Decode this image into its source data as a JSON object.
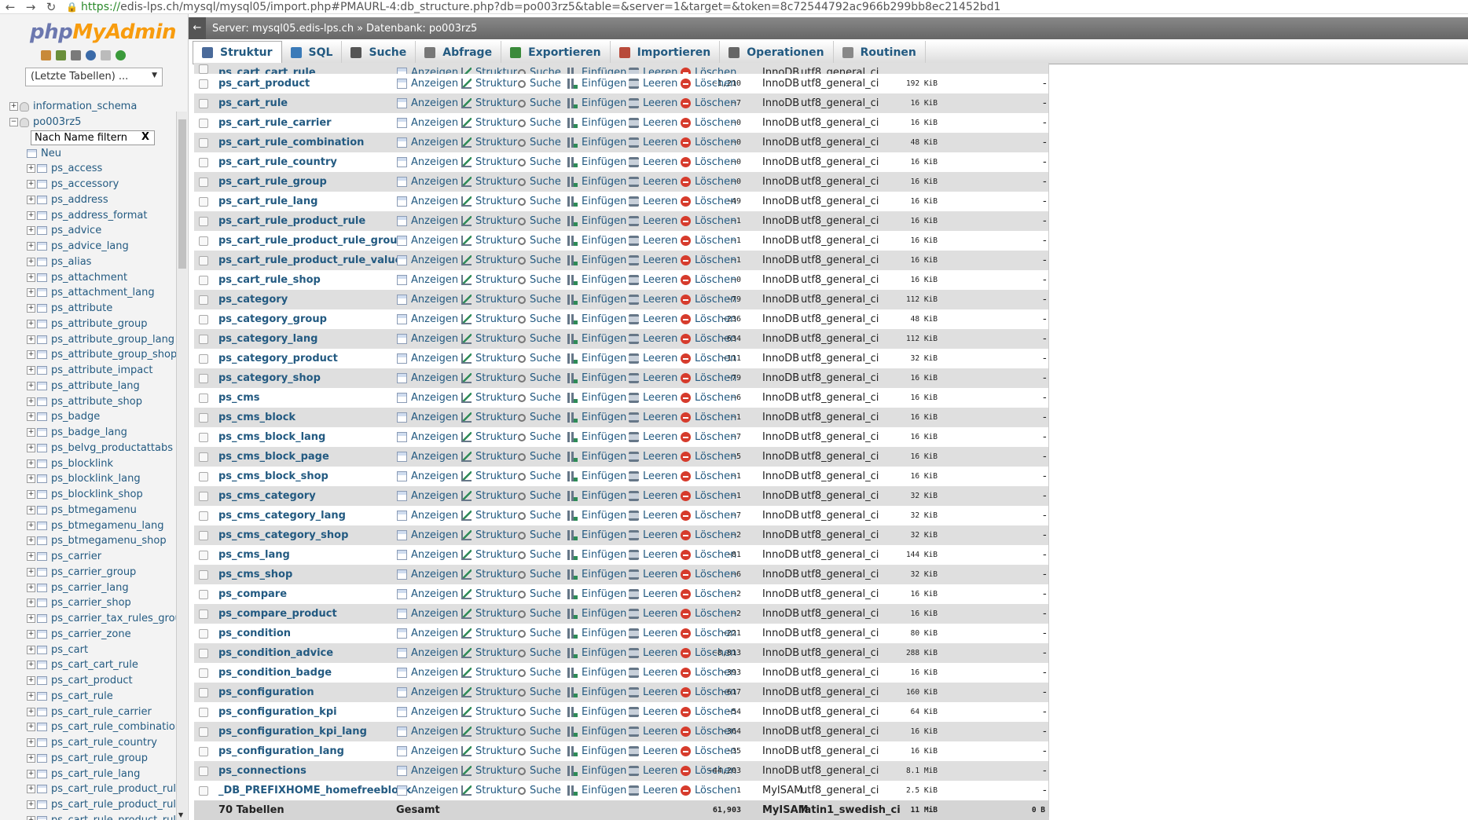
{
  "browser": {
    "url_scheme": "https://",
    "url_rest": "edis-lps.ch/mysql/mysql05/import.php#PMAURL-4:db_structure.php?db=po003rz5&table=&server=1&target=&token=8c72544792ac966b299bb8ec21452bd1"
  },
  "logo": {
    "php": "php",
    "my": "My",
    "admin": "Admin"
  },
  "sidebar": {
    "recent_tables": "(Letzte Tabellen) ...",
    "filter_placeholder": "Nach Name filtern",
    "filter_clear": "X",
    "new_label": "Neu",
    "databases": [
      "information_schema",
      "po003rz5"
    ],
    "tables": [
      "ps_access",
      "ps_accessory",
      "ps_address",
      "ps_address_format",
      "ps_advice",
      "ps_advice_lang",
      "ps_alias",
      "ps_attachment",
      "ps_attachment_lang",
      "ps_attribute",
      "ps_attribute_group",
      "ps_attribute_group_lang",
      "ps_attribute_group_shop",
      "ps_attribute_impact",
      "ps_attribute_lang",
      "ps_attribute_shop",
      "ps_badge",
      "ps_badge_lang",
      "ps_belvg_productattabs",
      "ps_blocklink",
      "ps_blocklink_lang",
      "ps_blocklink_shop",
      "ps_btmegamenu",
      "ps_btmegamenu_lang",
      "ps_btmegamenu_shop",
      "ps_carrier",
      "ps_carrier_group",
      "ps_carrier_lang",
      "ps_carrier_shop",
      "ps_carrier_tax_rules_grou",
      "ps_carrier_zone",
      "ps_cart",
      "ps_cart_cart_rule",
      "ps_cart_product",
      "ps_cart_rule",
      "ps_cart_rule_carrier",
      "ps_cart_rule_combination",
      "ps_cart_rule_country",
      "ps_cart_rule_group",
      "ps_cart_rule_lang",
      "ps_cart_rule_product_rule",
      "ps_cart_rule_product_rule",
      "ps_cart_rule_product_rule"
    ]
  },
  "breadcrumb": {
    "server": "Server: mysql05.edis-lps.ch",
    "sep": "»",
    "database": "Datenbank: po003rz5"
  },
  "tabs": [
    "Struktur",
    "SQL",
    "Suche",
    "Abfrage",
    "Exportieren",
    "Importieren",
    "Operationen",
    "Routinen"
  ],
  "actions": {
    "view": "Anzeigen",
    "structure": "Struktur",
    "search": "Suche",
    "insert": "Einfügen",
    "empty": "Leeren",
    "drop": "Löschen"
  },
  "partial_row": {
    "name": "ps_cart_cart_rule",
    "engine": "InnoDB",
    "collation": "utf8_general_ci"
  },
  "table_rows": [
    {
      "name": "ps_cart_product",
      "rows": "~1,210",
      "engine": "InnoDB",
      "collation": "utf8_general_ci",
      "size": "192 KiB",
      "overhead": "-"
    },
    {
      "name": "ps_cart_rule",
      "rows": "~7",
      "engine": "InnoDB",
      "collation": "utf8_general_ci",
      "size": "16 KiB",
      "overhead": "-"
    },
    {
      "name": "ps_cart_rule_carrier",
      "rows": "~0",
      "engine": "InnoDB",
      "collation": "utf8_general_ci",
      "size": "16 KiB",
      "overhead": "-"
    },
    {
      "name": "ps_cart_rule_combination",
      "rows": "~0",
      "engine": "InnoDB",
      "collation": "utf8_general_ci",
      "size": "48 KiB",
      "overhead": "-"
    },
    {
      "name": "ps_cart_rule_country",
      "rows": "~0",
      "engine": "InnoDB",
      "collation": "utf8_general_ci",
      "size": "16 KiB",
      "overhead": "-"
    },
    {
      "name": "ps_cart_rule_group",
      "rows": "~0",
      "engine": "InnoDB",
      "collation": "utf8_general_ci",
      "size": "16 KiB",
      "overhead": "-"
    },
    {
      "name": "ps_cart_rule_lang",
      "rows": "~49",
      "engine": "InnoDB",
      "collation": "utf8_general_ci",
      "size": "16 KiB",
      "overhead": "-"
    },
    {
      "name": "ps_cart_rule_product_rule",
      "rows": "~1",
      "engine": "InnoDB",
      "collation": "utf8_general_ci",
      "size": "16 KiB",
      "overhead": "-"
    },
    {
      "name": "ps_cart_rule_product_rule_group",
      "rows": "~1",
      "engine": "InnoDB",
      "collation": "utf8_general_ci",
      "size": "16 KiB",
      "overhead": "-"
    },
    {
      "name": "ps_cart_rule_product_rule_value",
      "rows": "~1",
      "engine": "InnoDB",
      "collation": "utf8_general_ci",
      "size": "16 KiB",
      "overhead": "-"
    },
    {
      "name": "ps_cart_rule_shop",
      "rows": "~0",
      "engine": "InnoDB",
      "collation": "utf8_general_ci",
      "size": "16 KiB",
      "overhead": "-"
    },
    {
      "name": "ps_category",
      "rows": "~79",
      "engine": "InnoDB",
      "collation": "utf8_general_ci",
      "size": "112 KiB",
      "overhead": "-"
    },
    {
      "name": "ps_category_group",
      "rows": "~236",
      "engine": "InnoDB",
      "collation": "utf8_general_ci",
      "size": "48 KiB",
      "overhead": "-"
    },
    {
      "name": "ps_category_lang",
      "rows": "~634",
      "engine": "InnoDB",
      "collation": "utf8_general_ci",
      "size": "112 KiB",
      "overhead": "-"
    },
    {
      "name": "ps_category_product",
      "rows": "~111",
      "engine": "InnoDB",
      "collation": "utf8_general_ci",
      "size": "32 KiB",
      "overhead": "-"
    },
    {
      "name": "ps_category_shop",
      "rows": "~79",
      "engine": "InnoDB",
      "collation": "utf8_general_ci",
      "size": "16 KiB",
      "overhead": "-"
    },
    {
      "name": "ps_cms",
      "rows": "~6",
      "engine": "InnoDB",
      "collation": "utf8_general_ci",
      "size": "16 KiB",
      "overhead": "-"
    },
    {
      "name": "ps_cms_block",
      "rows": "~1",
      "engine": "InnoDB",
      "collation": "utf8_general_ci",
      "size": "16 KiB",
      "overhead": "-"
    },
    {
      "name": "ps_cms_block_lang",
      "rows": "~7",
      "engine": "InnoDB",
      "collation": "utf8_general_ci",
      "size": "16 KiB",
      "overhead": "-"
    },
    {
      "name": "ps_cms_block_page",
      "rows": "~5",
      "engine": "InnoDB",
      "collation": "utf8_general_ci",
      "size": "16 KiB",
      "overhead": "-"
    },
    {
      "name": "ps_cms_block_shop",
      "rows": "~1",
      "engine": "InnoDB",
      "collation": "utf8_general_ci",
      "size": "16 KiB",
      "overhead": "-"
    },
    {
      "name": "ps_cms_category",
      "rows": "~1",
      "engine": "InnoDB",
      "collation": "utf8_general_ci",
      "size": "32 KiB",
      "overhead": "-"
    },
    {
      "name": "ps_cms_category_lang",
      "rows": "~7",
      "engine": "InnoDB",
      "collation": "utf8_general_ci",
      "size": "32 KiB",
      "overhead": "-"
    },
    {
      "name": "ps_cms_category_shop",
      "rows": "~2",
      "engine": "InnoDB",
      "collation": "utf8_general_ci",
      "size": "32 KiB",
      "overhead": "-"
    },
    {
      "name": "ps_cms_lang",
      "rows": "~81",
      "engine": "InnoDB",
      "collation": "utf8_general_ci",
      "size": "144 KiB",
      "overhead": "-"
    },
    {
      "name": "ps_cms_shop",
      "rows": "~6",
      "engine": "InnoDB",
      "collation": "utf8_general_ci",
      "size": "32 KiB",
      "overhead": "-"
    },
    {
      "name": "ps_compare",
      "rows": "~2",
      "engine": "InnoDB",
      "collation": "utf8_general_ci",
      "size": "16 KiB",
      "overhead": "-"
    },
    {
      "name": "ps_compare_product",
      "rows": "~2",
      "engine": "InnoDB",
      "collation": "utf8_general_ci",
      "size": "16 KiB",
      "overhead": "-"
    },
    {
      "name": "ps_condition",
      "rows": "~221",
      "engine": "InnoDB",
      "collation": "utf8_general_ci",
      "size": "80 KiB",
      "overhead": "-"
    },
    {
      "name": "ps_condition_advice",
      "rows": "~8,813",
      "engine": "InnoDB",
      "collation": "utf8_general_ci",
      "size": "288 KiB",
      "overhead": "-"
    },
    {
      "name": "ps_condition_badge",
      "rows": "~393",
      "engine": "InnoDB",
      "collation": "utf8_general_ci",
      "size": "16 KiB",
      "overhead": "-"
    },
    {
      "name": "ps_configuration",
      "rows": "~617",
      "engine": "InnoDB",
      "collation": "utf8_general_ci",
      "size": "160 KiB",
      "overhead": "-"
    },
    {
      "name": "ps_configuration_kpi",
      "rows": "~54",
      "engine": "InnoDB",
      "collation": "utf8_general_ci",
      "size": "64 KiB",
      "overhead": "-"
    },
    {
      "name": "ps_configuration_kpi_lang",
      "rows": "~364",
      "engine": "InnoDB",
      "collation": "utf8_general_ci",
      "size": "16 KiB",
      "overhead": "-"
    },
    {
      "name": "ps_configuration_lang",
      "rows": "~35",
      "engine": "InnoDB",
      "collation": "utf8_general_ci",
      "size": "16 KiB",
      "overhead": "-"
    },
    {
      "name": "ps_connections",
      "rows": "~44,203",
      "engine": "InnoDB",
      "collation": "utf8_general_ci",
      "size": "8.1 MiB",
      "overhead": "-"
    },
    {
      "name": "_DB_PREFIXHOME_homefreeblock",
      "rows": "1",
      "engine": "MyISAM",
      "collation": "utf8_general_ci",
      "size": "2.5 KiB",
      "overhead": "-"
    }
  ],
  "footer": {
    "count": "70 Tabellen",
    "label": "Gesamt",
    "rows": "61,903",
    "engine": "MyISAM",
    "collation": "latin1_swedish_ci",
    "size": "11 MiB",
    "overhead": "0 B"
  }
}
